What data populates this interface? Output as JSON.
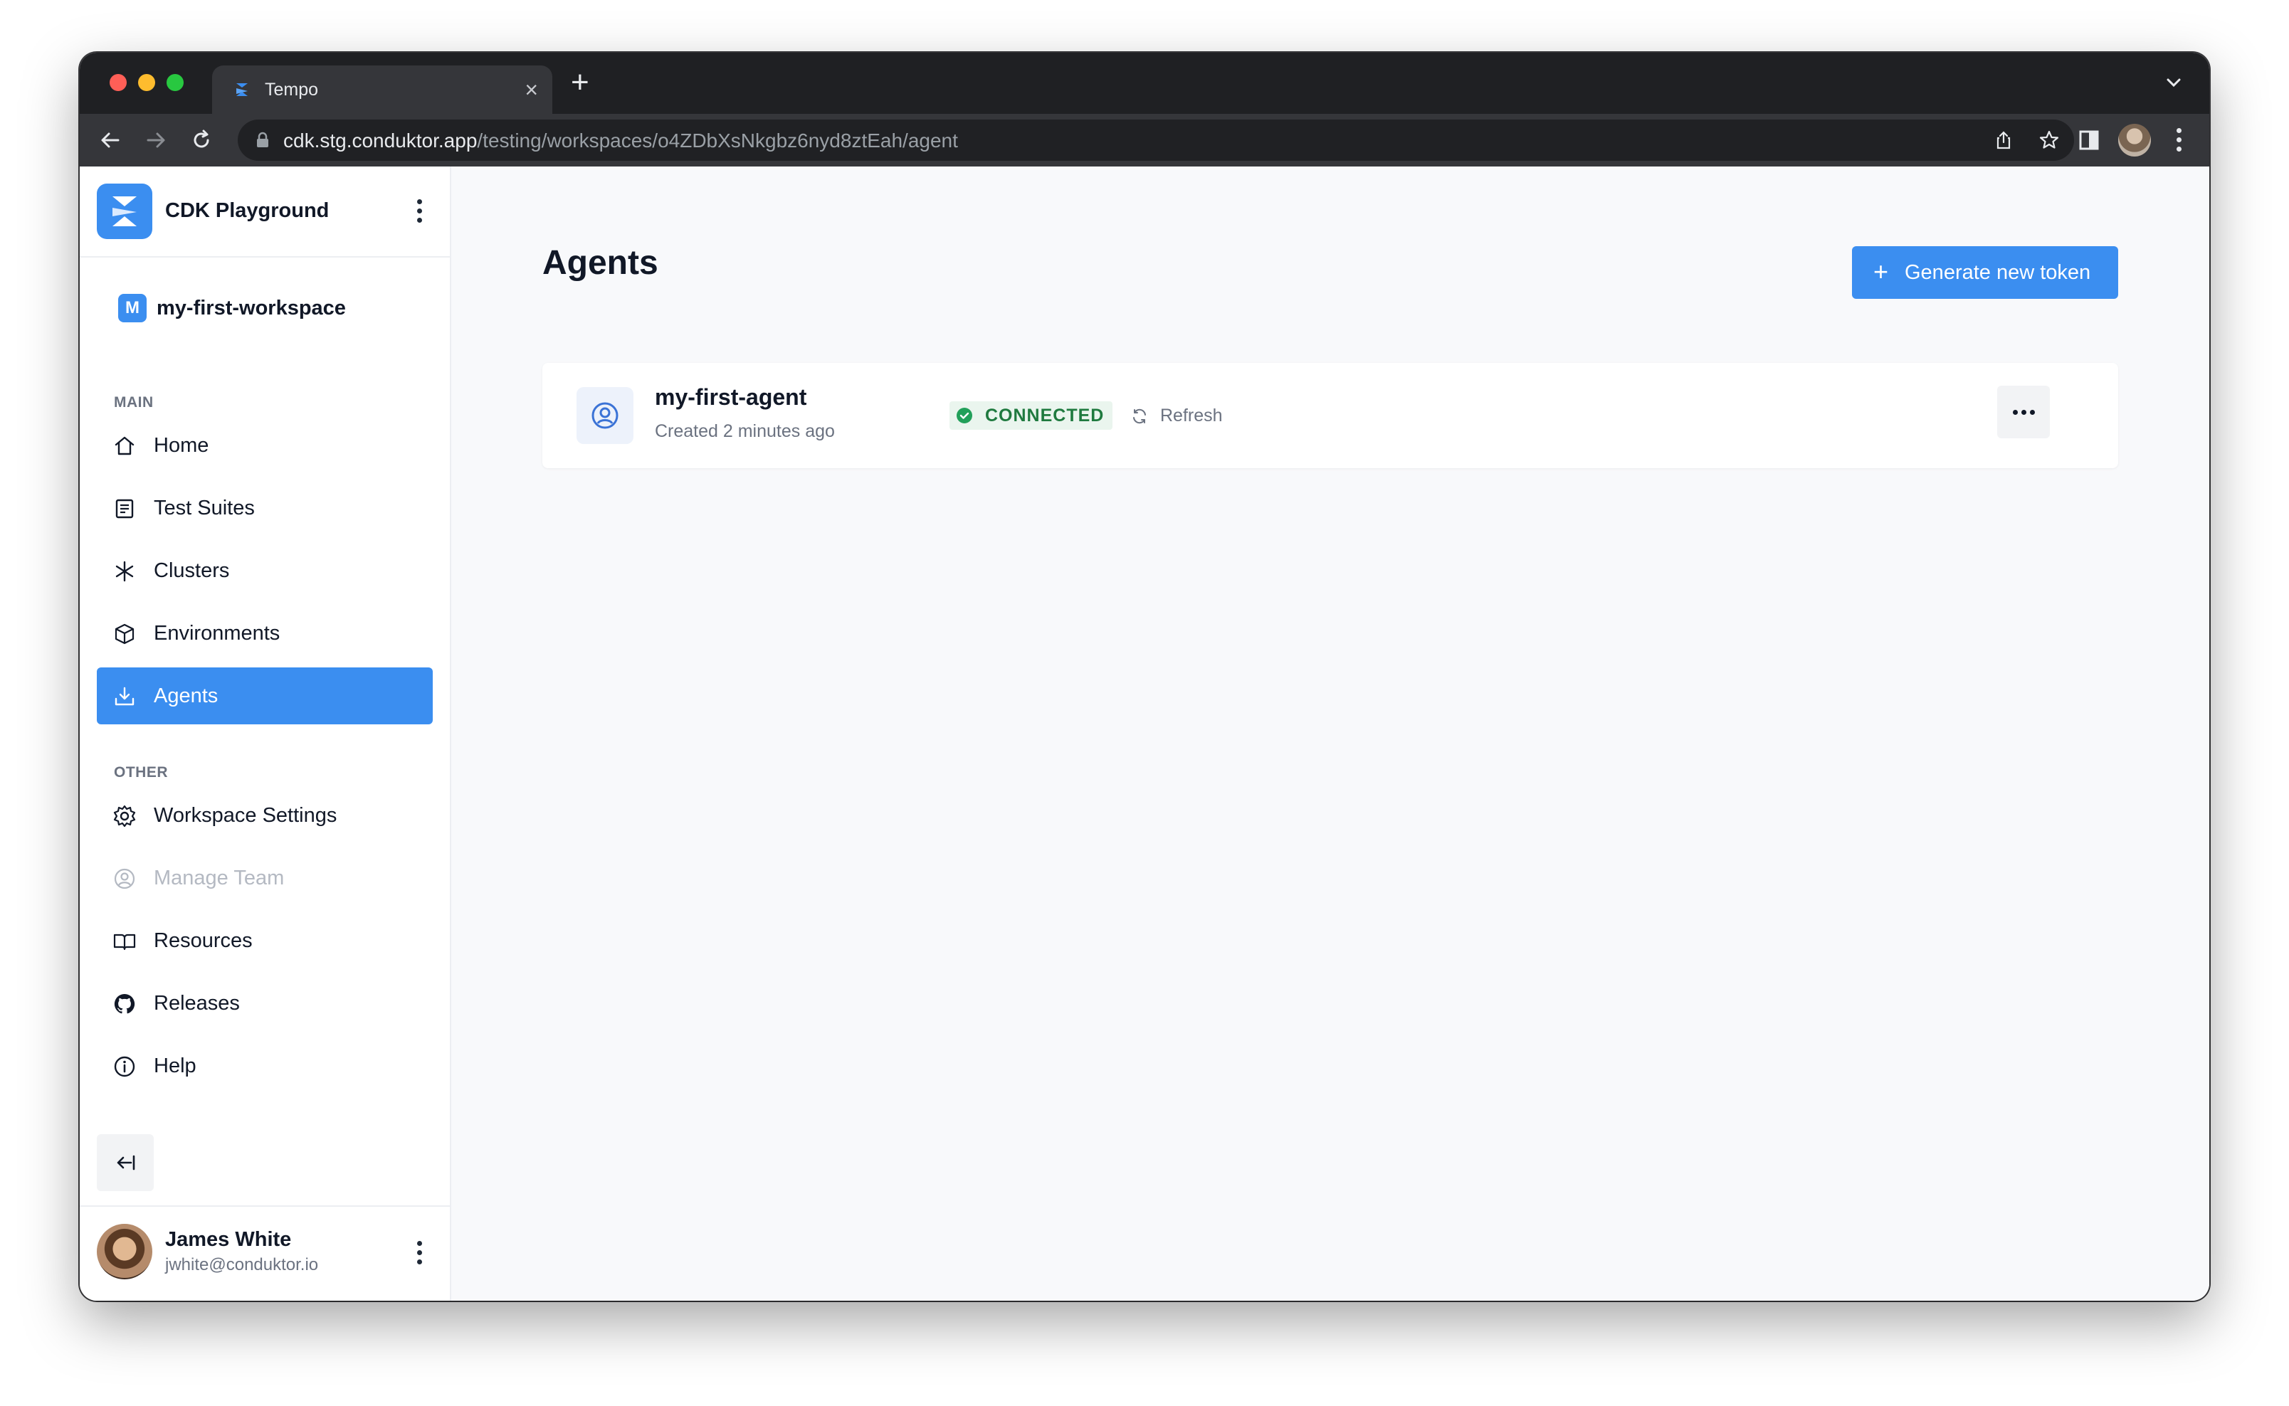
{
  "browser": {
    "tab_title": "Tempo",
    "url_host": "cdk.stg.conduktor.app",
    "url_path": "/testing/workspaces/o4ZDbXsNkgbz6nyd8ztEah/agent"
  },
  "sidebar": {
    "org_name": "CDK Playground",
    "workspace_badge": "M",
    "workspace_name": "my-first-workspace",
    "main_section_label": "MAIN",
    "main_items": [
      {
        "label": "Home",
        "icon": "home-icon"
      },
      {
        "label": "Test Suites",
        "icon": "document-icon"
      },
      {
        "label": "Clusters",
        "icon": "asterisk-icon"
      },
      {
        "label": "Environments",
        "icon": "cube-icon"
      },
      {
        "label": "Agents",
        "icon": "download-icon",
        "active": true
      }
    ],
    "other_section_label": "OTHER",
    "other_items": [
      {
        "label": "Workspace Settings",
        "icon": "gear-icon"
      },
      {
        "label": "Manage Team",
        "icon": "user-circle-icon",
        "disabled": true
      },
      {
        "label": "Resources",
        "icon": "book-icon"
      },
      {
        "label": "Releases",
        "icon": "github-icon"
      },
      {
        "label": "Help",
        "icon": "info-icon"
      }
    ],
    "user": {
      "name": "James White",
      "email": "jwhite@conduktor.io"
    }
  },
  "main": {
    "title": "Agents",
    "generate_button": "Generate new token",
    "agents": [
      {
        "name": "my-first-agent",
        "created": "Created 2 minutes ago",
        "status": "CONNECTED",
        "refresh_label": "Refresh"
      }
    ]
  },
  "colors": {
    "accent": "#3b8ef0",
    "status_green": "#1f7a3f",
    "status_bg": "#eaf5ee"
  }
}
